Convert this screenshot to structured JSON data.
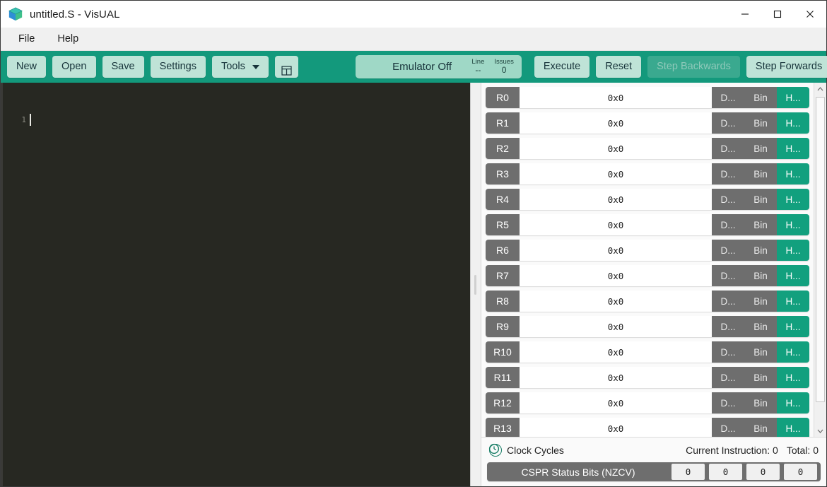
{
  "window": {
    "title": "untitled.S - VisUAL",
    "logo_icon": "cube-logo-icon",
    "controls": {
      "minimize": "─",
      "maximize": "☐",
      "close": "✕"
    }
  },
  "menubar": {
    "items": [
      {
        "label": "File"
      },
      {
        "label": "Help"
      }
    ]
  },
  "toolbar": {
    "left_buttons": [
      {
        "label": "New",
        "name": "new-button",
        "disabled": false
      },
      {
        "label": "Open",
        "name": "open-button",
        "disabled": false
      },
      {
        "label": "Save",
        "name": "save-button",
        "disabled": false
      },
      {
        "label": "Settings",
        "name": "settings-button",
        "disabled": false
      },
      {
        "label": "Tools",
        "name": "tools-button",
        "disabled": false,
        "caret": true
      }
    ],
    "panel_toggle": {
      "icon": "panel-layout-icon",
      "label": ""
    },
    "emulator": {
      "status_label": "Emulator Off",
      "line_key": "Line",
      "line_value": "--",
      "issues_key": "Issues",
      "issues_value": "0"
    },
    "right_buttons": [
      {
        "label": "Execute",
        "name": "execute-button",
        "disabled": false
      },
      {
        "label": "Reset",
        "name": "reset-button",
        "disabled": false
      },
      {
        "label": "Step Backwards",
        "name": "step-backwards-button",
        "disabled": true
      },
      {
        "label": "Step Forwards",
        "name": "step-forwards-button",
        "disabled": false
      }
    ]
  },
  "editor": {
    "line_numbers": [
      "1"
    ],
    "lines": [
      ""
    ],
    "cursor_line": 1,
    "background_color": "#272822"
  },
  "registers": {
    "mode_buttons": [
      "D...",
      "Bin",
      "H..."
    ],
    "active_mode": "H...",
    "rows": [
      {
        "name": "R0",
        "value": "0x0"
      },
      {
        "name": "R1",
        "value": "0x0"
      },
      {
        "name": "R2",
        "value": "0x0"
      },
      {
        "name": "R3",
        "value": "0x0"
      },
      {
        "name": "R4",
        "value": "0x0"
      },
      {
        "name": "R5",
        "value": "0x0"
      },
      {
        "name": "R6",
        "value": "0x0"
      },
      {
        "name": "R7",
        "value": "0x0"
      },
      {
        "name": "R8",
        "value": "0x0"
      },
      {
        "name": "R9",
        "value": "0x0"
      },
      {
        "name": "R10",
        "value": "0x0"
      },
      {
        "name": "R11",
        "value": "0x0"
      },
      {
        "name": "R12",
        "value": "0x0"
      },
      {
        "name": "R13",
        "value": "0x0"
      }
    ]
  },
  "status": {
    "clock_icon": "clock-icon",
    "clock_label": "Clock Cycles",
    "current_instruction_label": "Current Instruction:",
    "current_instruction_value": "0",
    "total_label": "Total:",
    "total_value": "0",
    "cspr_label": "CSPR Status Bits (NZCV)",
    "cspr_bits": [
      "0",
      "0",
      "0",
      "0"
    ]
  },
  "colors": {
    "toolbar_teal": "#13997c",
    "button_mint": "#bfe3d7",
    "accent_green": "#12a07e",
    "register_gray": "#6e6e6e",
    "editor_bg": "#272822"
  }
}
